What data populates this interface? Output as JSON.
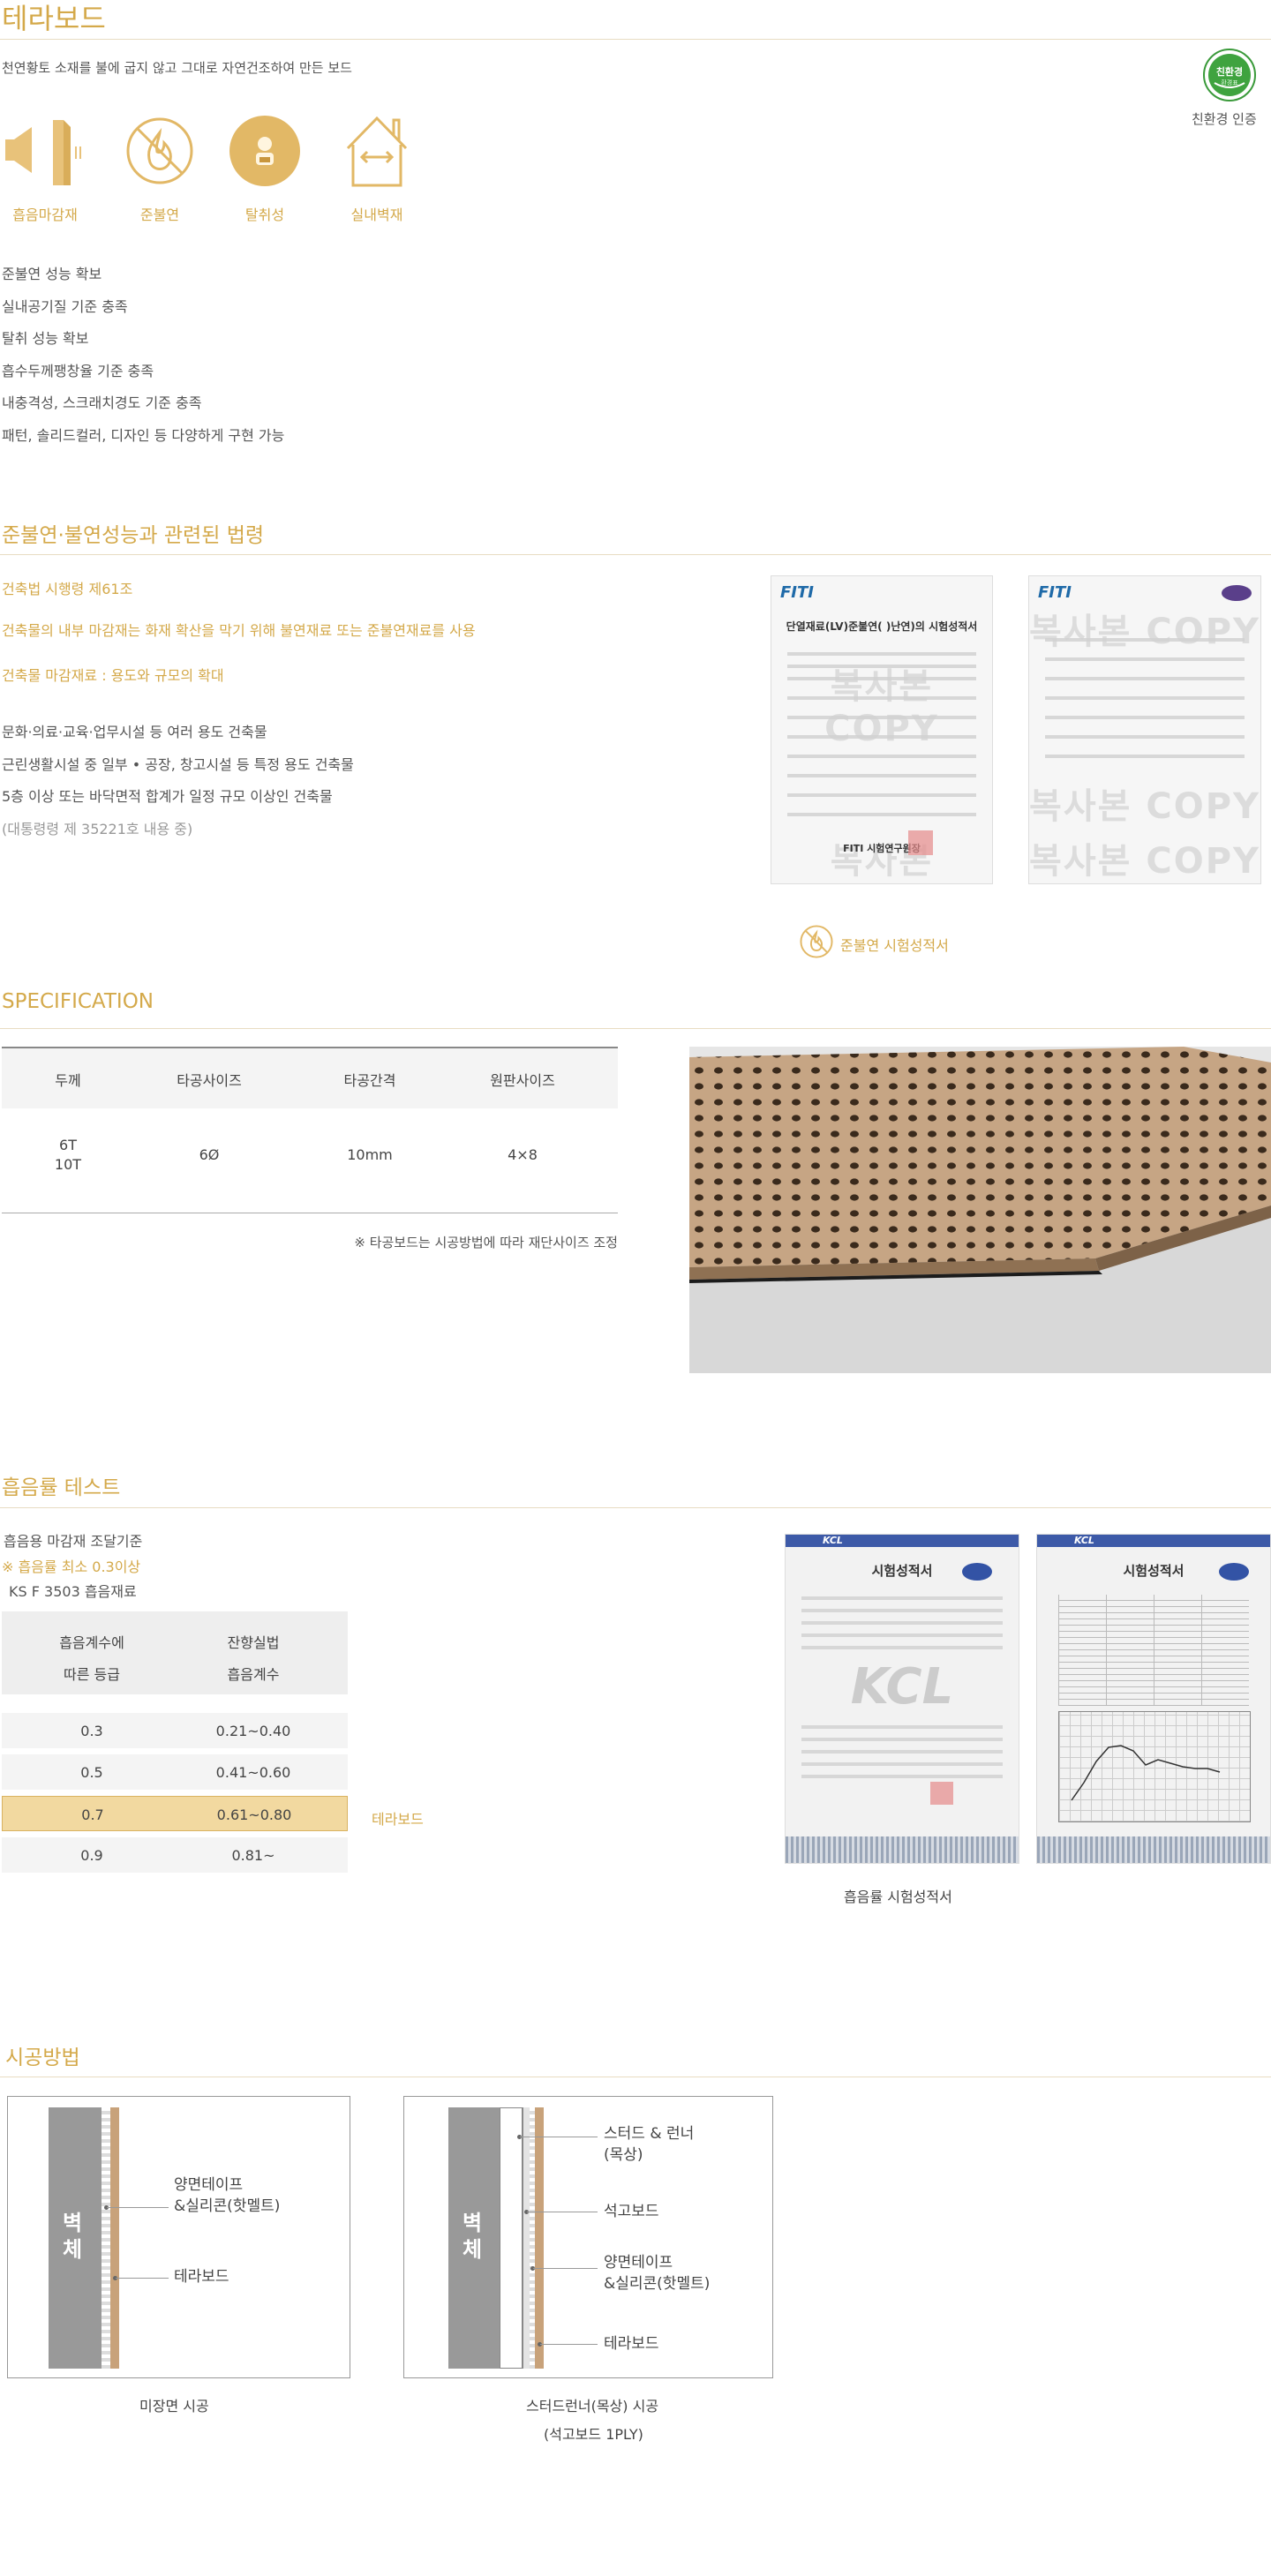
{
  "title": "테라보드",
  "subtitle": "천연황토 소재를 불에 굽지 않고 그대로 자연건조하여 만든 보드",
  "eco": {
    "badge_main": "친환경",
    "badge_sub": "환경표",
    "label": "친환경 인증"
  },
  "icons": [
    {
      "name": "sound-absorb-icon",
      "label": "흡음마감재"
    },
    {
      "name": "fire-retardant-icon",
      "label": "준불연"
    },
    {
      "name": "deodorize-icon",
      "label": "탈취성"
    },
    {
      "name": "interior-wall-icon",
      "label": "실내벽재"
    }
  ],
  "features": [
    "준불연 성능 확보",
    "실내공기질 기준 충족",
    "탈취 성능 확보",
    "흡수두께팽창율 기준 충족",
    "내충격성, 스크래치경도 기준 충족",
    "패턴, 솔리드컬러, 디자인 등 다양하게 구현 가능"
  ],
  "law": {
    "heading": "준불연·불연성능과 관련된 법령",
    "gold_lines": [
      "건축법 시행령 제61조",
      "건축물의 내부 마감재는 화재 확산을 막기 위해 불연재료 또는 준불연재료를 사용",
      "건축물 마감재료 : 용도와 규모의 확대"
    ],
    "lines": [
      "문화·의료·교육·업무시설 등 여러 용도 건축물",
      "근린생활시설 중 일부 • 공장, 창고시설 등 특정 용도 건축물",
      "5층 이상 또는 바닥면적 합계가 일정 규모 이상인 건축물"
    ],
    "note": "(대통령령 제 35221호 내용 중)",
    "doc1": {
      "logo": "FITI",
      "title": "단열재료(LV)준불연(  )난연)의 시험성적서",
      "stamp": "FITI 시험연구원장"
    },
    "doc2": {
      "logo": "FITI"
    },
    "watermark": "복사본 COPY",
    "caption": "준불연 시험성적서"
  },
  "spec": {
    "heading": "SPECIFICATION",
    "headers": [
      "두께",
      "타공사이즈",
      "타공간격",
      "원판사이즈"
    ],
    "row": {
      "thickness": [
        "6T",
        "10T"
      ],
      "hole_size": "6Ø",
      "hole_spacing": "10mm",
      "panel_size": "4×8"
    },
    "note": "※ 타공보드는 시공방법에 따라 재단사이즈 조정"
  },
  "absorption": {
    "heading": "흡음률 테스트",
    "line1": "흡음용 마감재 조달기준",
    "line2": "※ 흡음률 최소 0.3이상",
    "line3": "KS F 3503 흡음재료",
    "header_col1": [
      "흡음계수에",
      "따른 등급"
    ],
    "header_col2": [
      "잔향실법",
      "흡음계수"
    ],
    "rows": [
      {
        "grade": "0.3",
        "coef": "0.21~0.40",
        "highlight": false
      },
      {
        "grade": "0.5",
        "coef": "0.41~0.60",
        "highlight": false
      },
      {
        "grade": "0.7",
        "coef": "0.61~0.80",
        "highlight": true
      },
      {
        "grade": "0.9",
        "coef": "0.81~",
        "highlight": false
      }
    ],
    "row_label": "테라보드",
    "doc1": {
      "logo": "KCL",
      "title": "시험성적서"
    },
    "doc2": {
      "logo": "KCL",
      "title": "시험성적서"
    },
    "caption": "흡음률 시험성적서"
  },
  "install": {
    "heading": "시공방법",
    "wall_label": "벽체",
    "d1": {
      "labels": [
        "양면테이프",
        "&실리콘(핫멜트)",
        "테라보드"
      ],
      "caption": "미장면 시공"
    },
    "d2": {
      "labels": [
        "스터드 & 런너",
        "(목상)",
        "석고보드",
        "양면테이프",
        "&실리콘(핫멜트)",
        "테라보드"
      ],
      "caption1": "스터드런너(목상) 시공",
      "caption2": "(석고보드 1PLY)"
    }
  },
  "colors": {
    "accent": "#d4a94a",
    "highlight": "#f2d9a0",
    "wall": "#999999",
    "board": "#c8a27a"
  }
}
